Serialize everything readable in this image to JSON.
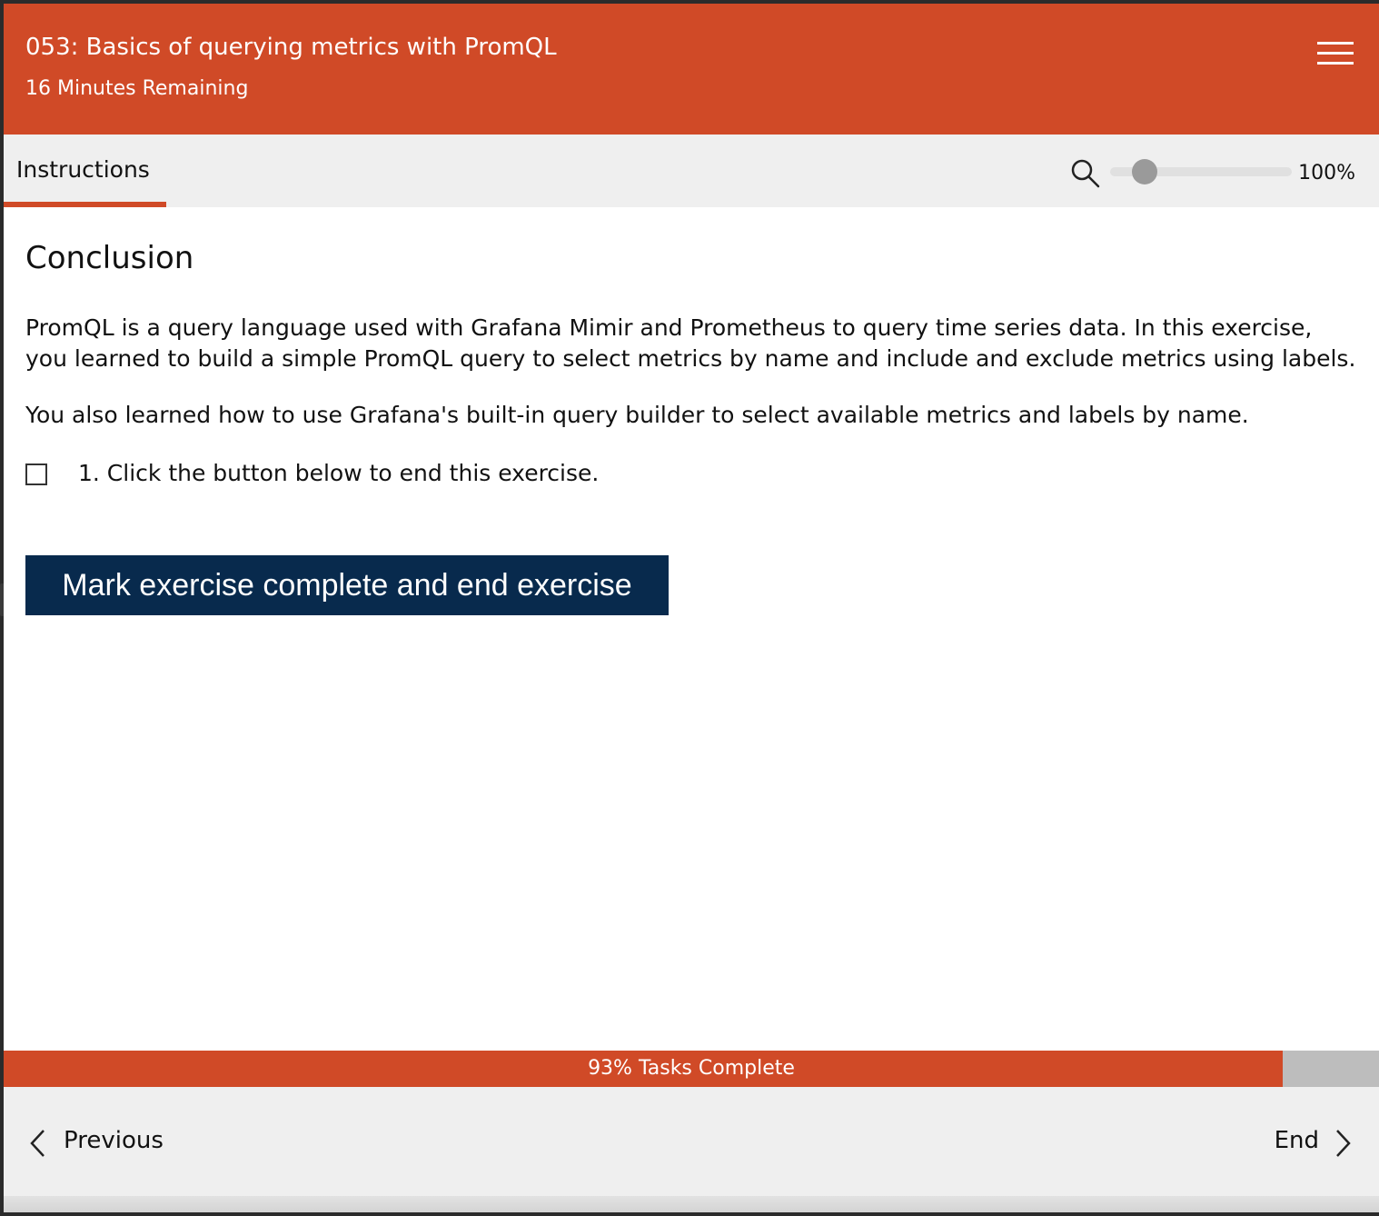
{
  "header": {
    "title": "053: Basics of querying metrics with PromQL",
    "subtitle": "16 Minutes Remaining",
    "menu_icon": "hamburger-menu-icon"
  },
  "tabs": {
    "active": "Instructions"
  },
  "zoom": {
    "icon": "magnifier-icon",
    "value": "100%",
    "level": 1.0
  },
  "content": {
    "heading": "Conclusion",
    "paragraph1": "PromQL is a query language used with Grafana Mimir and Prometheus to query time series data. In this exercise, you learned to build a simple PromQL query to select metrics by name and include and exclude metrics using labels.",
    "paragraph2": "You also learned how to use Grafana's built-in query builder to select available metrics and labels by name.",
    "task": {
      "text": "1. Click the button below to end this exercise.",
      "checked": false
    },
    "end_button": "Mark exercise complete and end exercise"
  },
  "progress": {
    "label": "93% Tasks Complete",
    "fraction": 0.93,
    "fill_color": "#d04a27",
    "track_color": "#bdbdbd"
  },
  "footer": {
    "previous": "Previous",
    "next": "End"
  },
  "colors": {
    "brand": "#d04a27",
    "button": "#082a4d"
  }
}
